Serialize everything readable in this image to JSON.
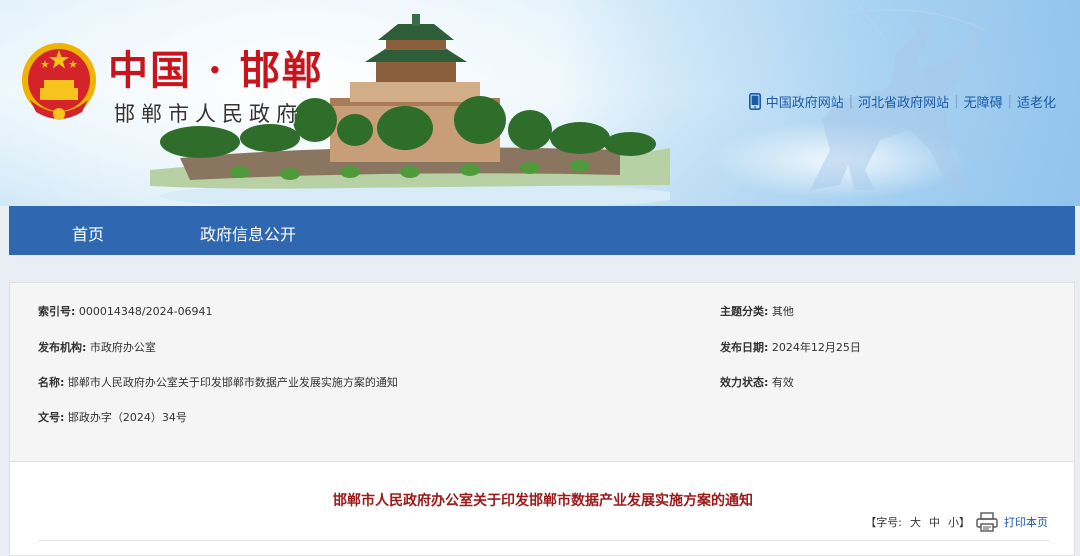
{
  "header": {
    "logo_icon": "national-emblem-icon",
    "site_title": "中国 · 邯郸",
    "site_subtitle": "邯郸市人民政府",
    "links": [
      {
        "label": "中国政府网站"
      },
      {
        "label": "河北省政府网站"
      },
      {
        "label": "无障碍"
      },
      {
        "label": "适老化"
      }
    ],
    "phone_icon": "mobile-phone-icon"
  },
  "nav": {
    "items": [
      {
        "label": "首页"
      },
      {
        "label": "政府信息公开"
      }
    ]
  },
  "meta": {
    "index_no": {
      "label": "索引号:",
      "value": "000014348/2024-06941"
    },
    "category": {
      "label": "主题分类:",
      "value": "其他"
    },
    "publisher": {
      "label": "发布机构:",
      "value": "市政府办公室"
    },
    "publish_date": {
      "label": "发布日期:",
      "value": "2024年12月25日"
    },
    "name": {
      "label": "名称:",
      "value": "邯郸市人民政府办公室关于印发邯郸市数据产业发展实施方案的通知"
    },
    "validity": {
      "label": "效力状态:",
      "value": "有效"
    },
    "doc_no": {
      "label": "文号:",
      "value": "邯政办字（2024）34号"
    }
  },
  "article": {
    "title": "邯郸市人民政府办公室关于印发邯郸市数据产业发展实施方案的通知",
    "font_size_label": "【字号:",
    "font_large": "大",
    "font_medium": "中",
    "font_small": "小】",
    "print_label": "打印本页",
    "print_icon": "printer-icon"
  },
  "colors": {
    "nav_bg": "#2f67b1",
    "title_red": "#c8151d",
    "doc_title": "#9a1a1a",
    "link_blue": "#1a5aa8"
  }
}
